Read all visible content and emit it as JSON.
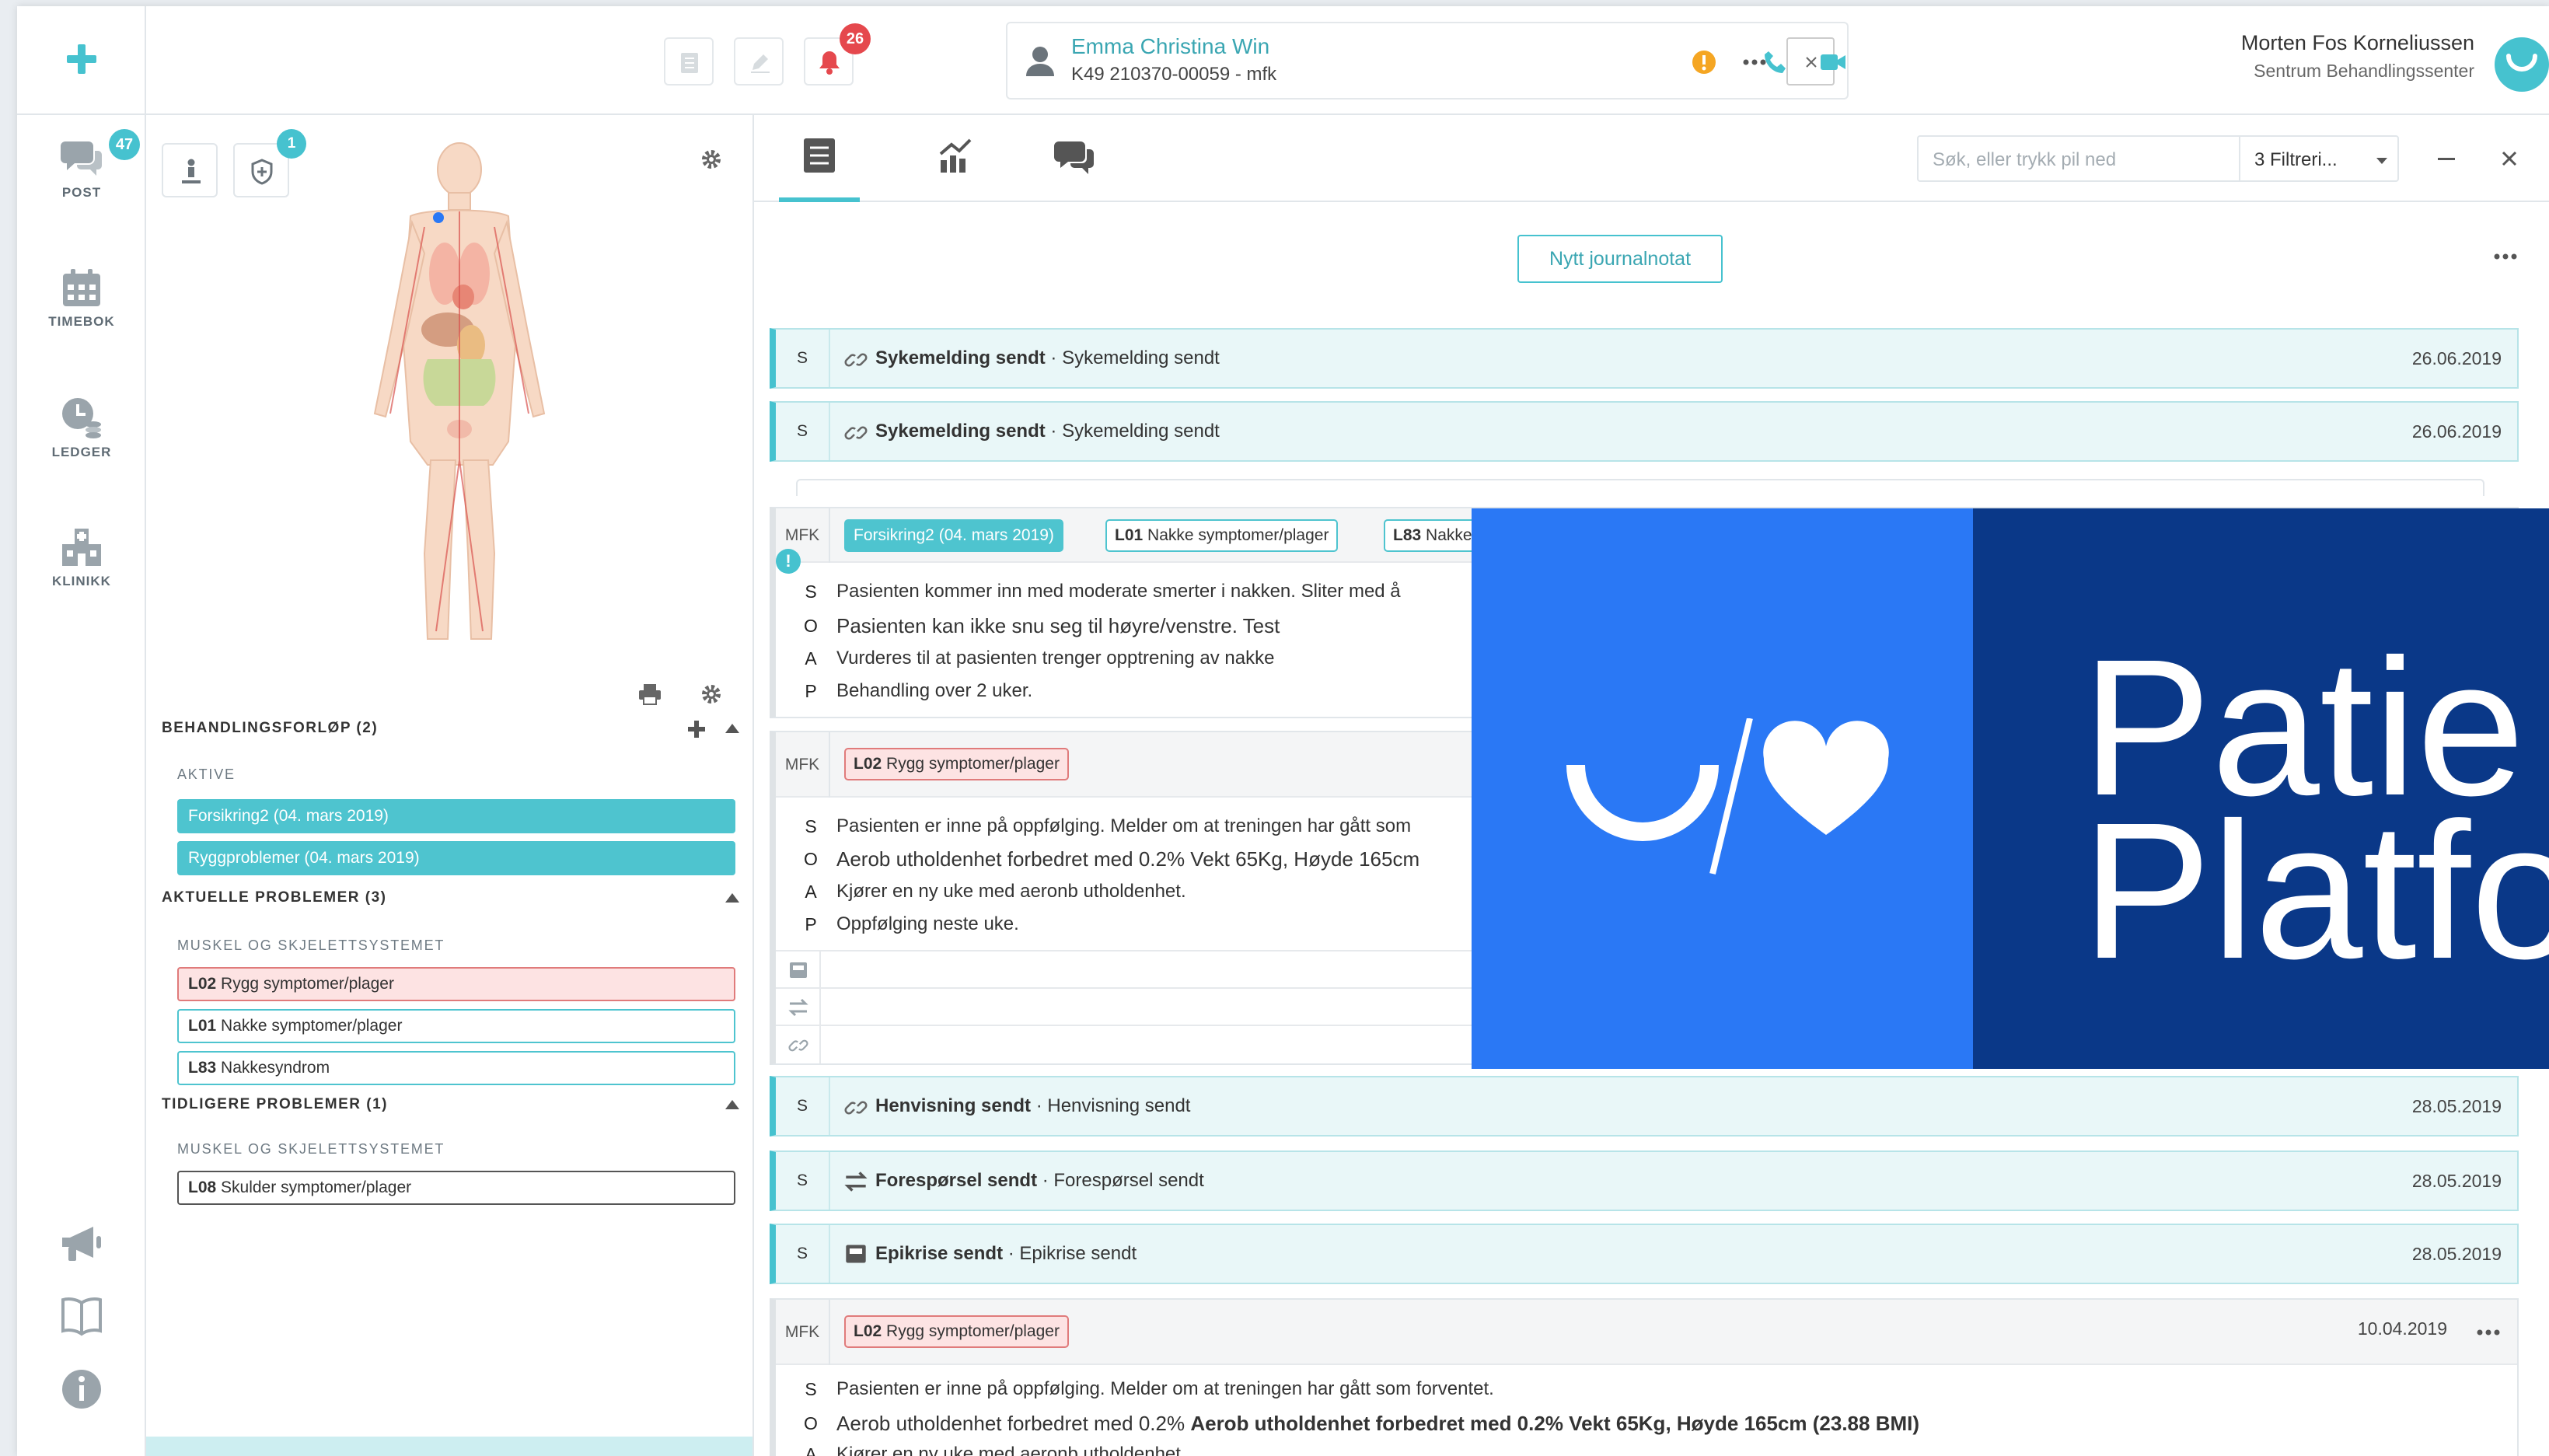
{
  "nav": {
    "items": [
      {
        "label": "POST",
        "badge": "47"
      },
      {
        "label": "TIMEBOK"
      },
      {
        "label": "LEDGER"
      },
      {
        "label": "KLINIKK"
      }
    ]
  },
  "topbar": {
    "notification_count": "26",
    "patient": {
      "name": "Emma Christina Win",
      "id": "K49 210370-00059 - mfk"
    },
    "user": {
      "name": "Morten Fos Korneliussen",
      "clinic": "Sentrum Behandlingssenter"
    }
  },
  "body_panel": {
    "shield_badge": "1"
  },
  "treatment": {
    "title": "BEHANDLINGSFORLØP (2)",
    "active_label": "AKTIVE",
    "items": [
      "Forsikring2 (04. mars 2019)",
      "Ryggproblemer (04. mars 2019)"
    ]
  },
  "current_problems": {
    "title": "AKTUELLE PROBLEMER (3)",
    "group": "MUSKEL OG SKJELETTSYSTEMET",
    "items": [
      {
        "code": "L02",
        "text": "Rygg symptomer/plager"
      },
      {
        "code": "L01",
        "text": "Nakke symptomer/plager"
      },
      {
        "code": "L83",
        "text": "Nakkesyndrom"
      }
    ]
  },
  "past_problems": {
    "title": "TIDLIGERE PROBLEMER (1)",
    "group": "MUSKEL OG SKJELETTSYSTEMET",
    "items": [
      {
        "code": "L08",
        "text": "Skulder symptomer/plager"
      }
    ]
  },
  "journal": {
    "search_placeholder": "Søk, eller trykk pil ned",
    "filter": "3 Filtreri...",
    "new_note": "Nytt journalnotat",
    "events": [
      {
        "tag": "S",
        "title": "Sykemelding sendt",
        "sub": "Sykemelding sendt",
        "date": "26.06.2019"
      },
      {
        "tag": "S",
        "title": "Sykemelding sendt",
        "sub": "Sykemelding sendt",
        "date": "26.06.2019"
      },
      {
        "tag": "S",
        "title": "Henvisning sendt",
        "sub": "Henvisning sendt",
        "date": "28.05.2019"
      },
      {
        "tag": "S",
        "title": "Forespørsel sendt",
        "sub": "Forespørsel sendt",
        "date": "28.05.2019"
      },
      {
        "tag": "S",
        "title": "Epikrise sendt",
        "sub": "Epikrise sendt",
        "date": "28.05.2019"
      }
    ],
    "note1": {
      "tag": "MFK",
      "chips": [
        "Forsikring2 (04. mars 2019)",
        "L01",
        "Nakke symptomer/plager",
        "L83",
        "Nakke"
      ],
      "soap": [
        {
          "k": "S",
          "v": "Pasienten kommer inn med moderate smerter i nakken. Sliter med å"
        },
        {
          "k": "O",
          "v": "Pasienten kan ikke snu seg til høyre/venstre. Test"
        },
        {
          "k": "A",
          "v": "Vurderes til at pasienten trenger opptrening av nakke"
        },
        {
          "k": "P",
          "v": "Behandling over 2 uker."
        }
      ]
    },
    "note2": {
      "tag": "MFK",
      "chips": [
        "L02",
        "Rygg symptomer/plager"
      ],
      "soap": [
        {
          "k": "S",
          "v": "Pasienten er inne på oppfølging. Melder om at treningen har gått som"
        },
        {
          "k": "O",
          "v": "Aerob utholdenhet forbedret med 0.2% Vekt 65Kg, Høyde 165cm"
        },
        {
          "k": "A",
          "v": "Kjører en ny uke med aeronb utholdenhet."
        },
        {
          "k": "P",
          "v": "Oppfølging neste uke."
        }
      ]
    },
    "note3": {
      "tag": "MFK",
      "chips": [
        "L02",
        "Rygg symptomer/plager"
      ],
      "date": "10.04.2019",
      "soap": [
        {
          "k": "S",
          "v": "Pasienten er inne på oppfølging. Melder om at treningen har gått som forventet."
        },
        {
          "k": "O",
          "v": "Aerob utholdenhet forbedret med 0.2%",
          "vb": "Aerob utholdenhet forbedret med 0.2% Vekt 65Kg, Høyde 165cm (23.88 BMI)"
        },
        {
          "k": "A",
          "v": "Kjører en ny uke med aeronb utholdenhet."
        }
      ]
    }
  },
  "overlay": {
    "line1": "Patie",
    "line2": "Platfo"
  },
  "colors": {
    "accent": "#46c2cf",
    "danger": "#e5484d",
    "overlay_blue": "#2a78f5",
    "overlay_navy": "#0a3888"
  }
}
